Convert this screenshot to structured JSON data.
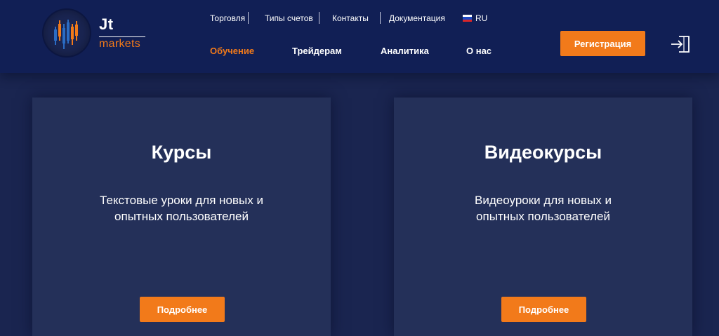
{
  "logo": {
    "brand": "Jt",
    "sub": "markets"
  },
  "top_nav": [
    {
      "label": "Торговля"
    },
    {
      "label": "Типы счетов"
    },
    {
      "label": "Контакты"
    },
    {
      "label": "Документация"
    }
  ],
  "language": {
    "code": "RU"
  },
  "main_nav": [
    {
      "label": "Обучение",
      "active": true
    },
    {
      "label": "Трейдерам",
      "active": false
    },
    {
      "label": "Аналитика",
      "active": false
    },
    {
      "label": "О нас",
      "active": false
    }
  ],
  "register_label": "Регистрация",
  "cards": [
    {
      "title": "Курсы",
      "description": "Текстовые уроки для новых и опытных пользователей",
      "button": "Подробнее"
    },
    {
      "title": "Видеокурсы",
      "description": "Видеоуроки для новых и опытных пользователей",
      "button": "Подробнее"
    }
  ],
  "colors": {
    "accent": "#f27a1a",
    "header_bg": "#111f55",
    "page_bg": "#1a2550",
    "card_bg": "#243059",
    "logo_bars": "#2b6cc4"
  }
}
